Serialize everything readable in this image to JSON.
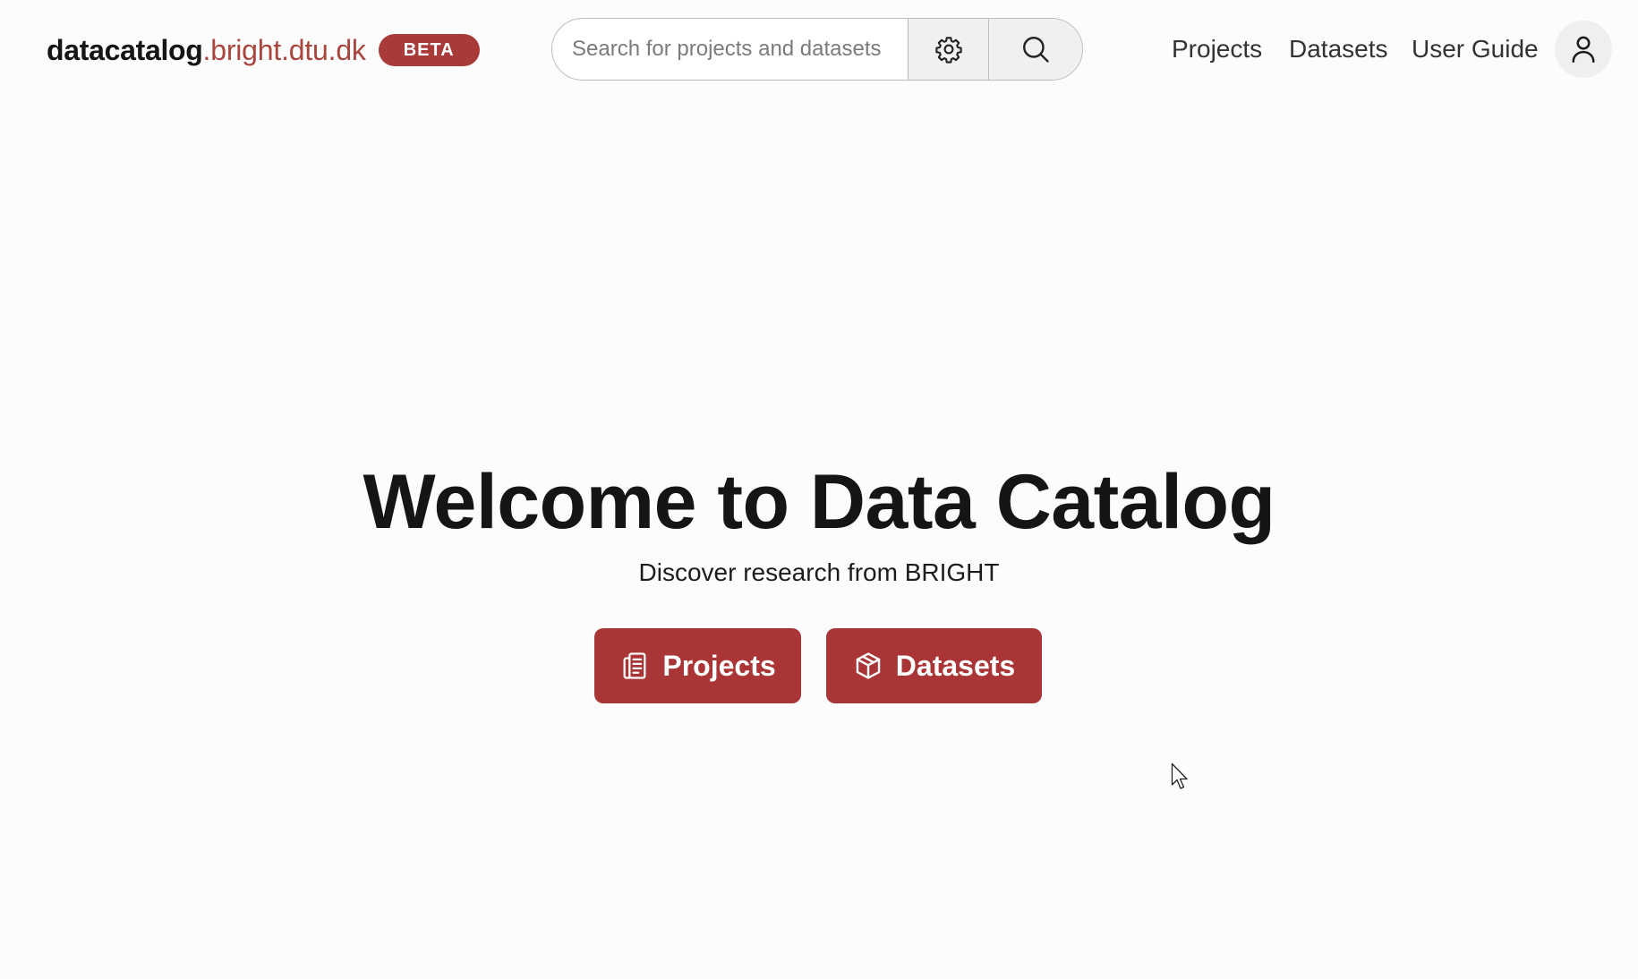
{
  "header": {
    "brand_main": "datacatalog",
    "brand_domain": ".bright.dtu.dk",
    "badge": "BETA",
    "search_placeholder": "Search for projects and datasets",
    "nav": [
      "Projects",
      "Datasets",
      "User Guide"
    ],
    "icons": {
      "settings": "gear-icon",
      "search": "search-icon",
      "account": "user-icon"
    }
  },
  "hero": {
    "title": "Welcome to Data Catalog",
    "subtitle": "Discover research from BRIGHT",
    "buttons": [
      {
        "label": "Projects",
        "icon": "document-stack-icon"
      },
      {
        "label": "Datasets",
        "icon": "box-icon"
      }
    ]
  },
  "colors": {
    "accent": "#a93537",
    "brand_domain": "#a9453d",
    "text": "#151515",
    "background": "#fdfcfc"
  }
}
